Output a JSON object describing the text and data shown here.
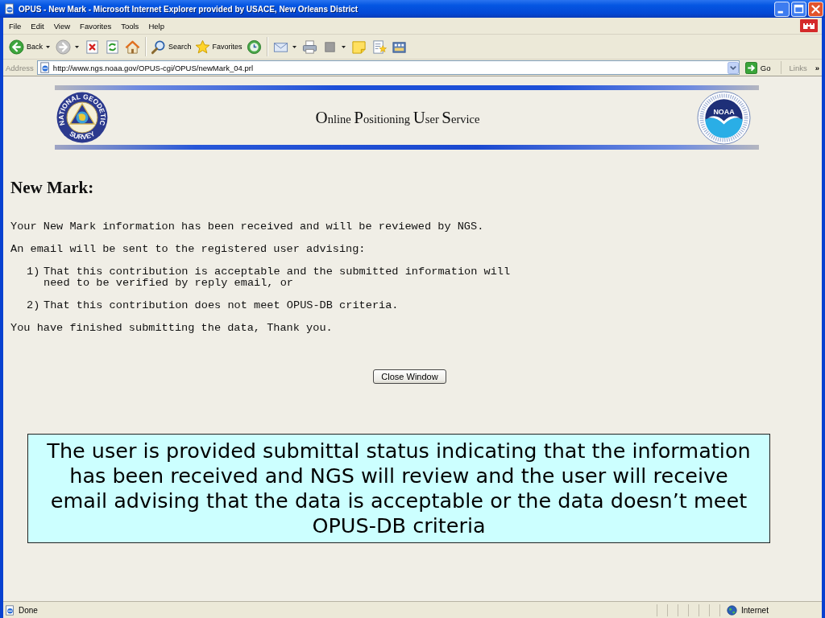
{
  "window": {
    "title": "OPUS - New Mark - Microsoft Internet Explorer provided by USACE, New Orleans District"
  },
  "menu_bar": [
    "File",
    "Edit",
    "View",
    "Favorites",
    "Tools",
    "Help"
  ],
  "toolbar": [
    {
      "kind": "back",
      "label": "Back",
      "dropdown": true
    },
    {
      "kind": "forward",
      "dropdown": true
    },
    {
      "kind": "stop",
      "dropdown": false
    },
    {
      "kind": "refresh",
      "dropdown": false
    },
    {
      "kind": "home",
      "dropdown": false
    },
    {
      "kind": "separator"
    },
    {
      "kind": "search",
      "label": "Search",
      "dropdown": false
    },
    {
      "kind": "favorites",
      "label": "Favorites",
      "dropdown": false
    },
    {
      "kind": "history",
      "dropdown": false
    },
    {
      "kind": "separator"
    },
    {
      "kind": "mail",
      "dropdown": true
    },
    {
      "kind": "print",
      "dropdown": false
    },
    {
      "kind": "edit",
      "dropdown": true
    },
    {
      "kind": "note",
      "dropdown": false
    },
    {
      "kind": "research",
      "dropdown": false
    },
    {
      "kind": "messenger",
      "dropdown": false
    }
  ],
  "address_bar": {
    "label": "Address",
    "url": "http://www.ngs.noaa.gov/OPUS-cgi/OPUS/newMark_04.prl",
    "go": "Go",
    "links": "Links",
    "more": "»"
  },
  "banner": {
    "left_logo": {
      "ring_top": "NATIONAL GEODETIC",
      "ring_bottom": "SURVEY"
    },
    "title": "Online Positioning User Service",
    "right_logo": {
      "text": "NOAA"
    }
  },
  "content": {
    "heading": "New Mark:",
    "blocks": [
      {
        "kind": "paragraph",
        "text": "Your New Mark information has been received and will be reviewed by NGS."
      },
      {
        "kind": "paragraph",
        "text": "An email will be sent to the registered user advising:"
      },
      {
        "kind": "list_item",
        "number": "1)",
        "text": "That this contribution is acceptable and the submitted information will need to be verified by reply email, or"
      },
      {
        "kind": "list_item",
        "number": "2)",
        "text": "That this contribution does not meet OPUS-DB criteria."
      },
      {
        "kind": "paragraph",
        "text": "You have finished submitting the data, Thank you."
      }
    ],
    "button": "Close Window"
  },
  "callout": {
    "text": "The user is provided submittal status indicating that the information has been received and NGS will review and the user will receive email advising that the data is acceptable or the data doesn’t meet OPUS-DB criteria"
  },
  "status_bar": {
    "status": "Done",
    "zone": "Internet"
  }
}
